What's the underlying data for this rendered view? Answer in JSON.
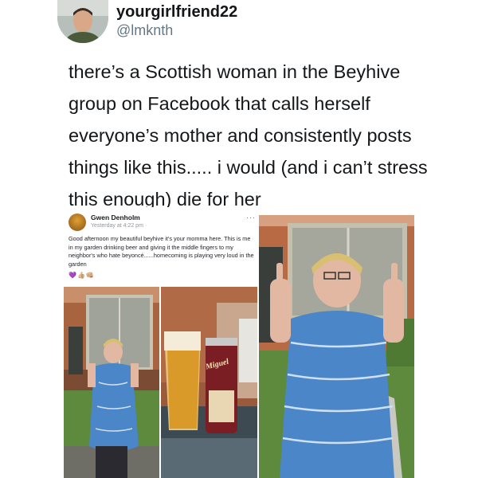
{
  "tweet": {
    "display_name": "yourgirlfriend22",
    "handle": "@lmknth",
    "text": "there’s a Scottish woman in the Beyhive group on Facebook that calls herself everyone’s mother and consistently posts things like this..... i would (and i can’t stress this enough) die for her"
  },
  "fb_post": {
    "author": "Gwen Denholm",
    "time": "Yesterday at 4:22 pm ·",
    "more": "···",
    "body": "Good afternoon my beautiful beyhive it's your momma here. This is me in my garden drinking beer and giving it the middle fingers to my neighbor's who hate beyoncé......homecoming is playing very loud in the garden",
    "emoji": "💜👍🏼👊🏼"
  },
  "photos": {
    "can_brand": "Miguel"
  },
  "colors": {
    "text": "#14171a",
    "handle": "#657786",
    "dress_blue": "#4a86c8",
    "brick": "#9a5a3c",
    "grass": "#5a8a3a",
    "beer": "#d99a2a"
  },
  "icons": [
    "avatar-photo",
    "globe-icon",
    "more-icon"
  ]
}
